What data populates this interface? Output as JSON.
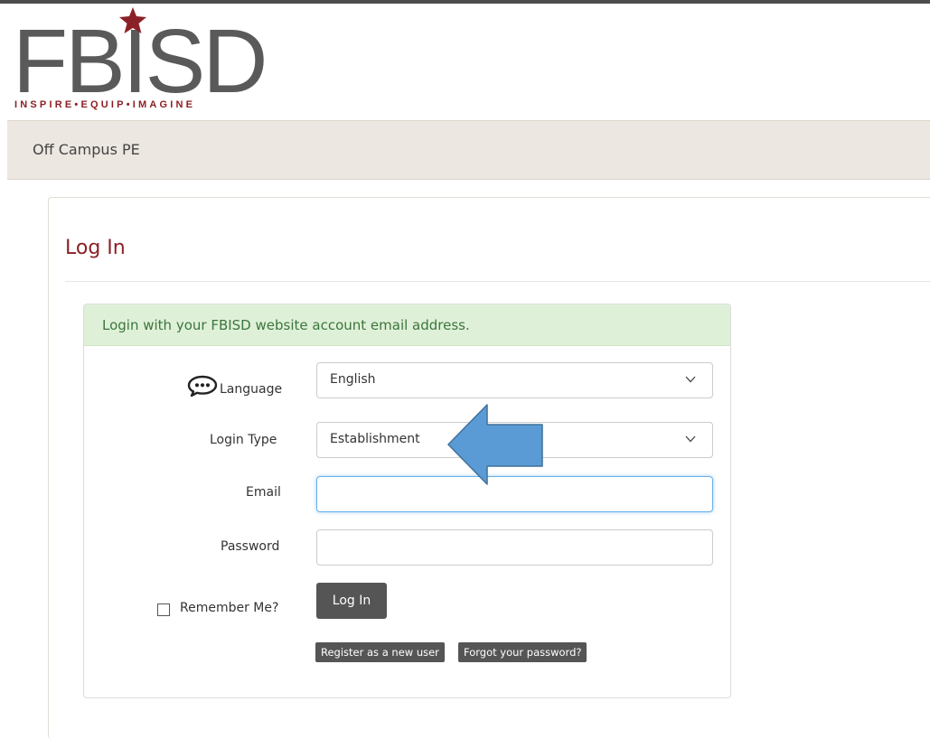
{
  "brand": {
    "logo_text": "FBISD",
    "tagline": "INSPIRE•EQUIP•IMAGINE",
    "logo_color": "#5a5a5a",
    "accent_color": "#8b2126"
  },
  "navbar": {
    "title": "Off Campus PE"
  },
  "page": {
    "heading": "Log In"
  },
  "login_card": {
    "notice": "Login with your FBISD website account email address.",
    "notice_bg": "#dff0d8",
    "notice_color": "#3c763d"
  },
  "form": {
    "language": {
      "label": "Language",
      "value": "English",
      "icon": "speech-bubble-icon"
    },
    "login_type": {
      "label": "Login Type",
      "value": "Establishment"
    },
    "email": {
      "label": "Email",
      "value": ""
    },
    "password": {
      "label": "Password",
      "value": ""
    },
    "remember": {
      "label": "Remember Me?",
      "checked": false
    },
    "submit_label": "Log In",
    "register_label": "Register as a new user",
    "forgot_label": "Forgot your password?"
  },
  "annotation": {
    "icon": "left-arrow-icon",
    "color": "#5b9bd5"
  }
}
